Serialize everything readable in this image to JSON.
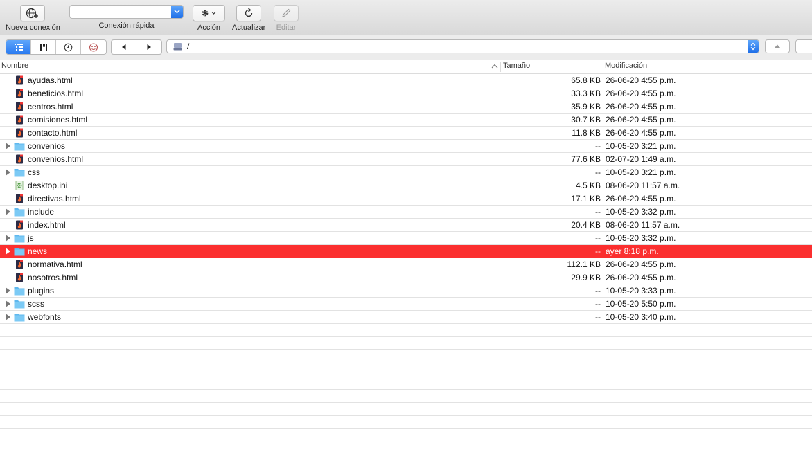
{
  "toolbar": {
    "new_connection_label": "Nueva conexión",
    "quick_connect_label": "Conexión rápida",
    "quick_connect_value": "",
    "action_label": "Acción",
    "refresh_label": "Actualizar",
    "edit_label": "Editar"
  },
  "navbar": {
    "path": "/"
  },
  "columns": {
    "name": "Nombre",
    "size": "Tamaño",
    "modified": "Modificación"
  },
  "colors": {
    "selection": "#fb2f2f",
    "folder": "#5fb8ee",
    "accent": "#2a7af0"
  },
  "files": [
    {
      "name": "ayudas.html",
      "kind": "html",
      "size": "65.8 KB",
      "modified": "26-06-20 4:55 p.m."
    },
    {
      "name": "beneficios.html",
      "kind": "html",
      "size": "33.3 KB",
      "modified": "26-06-20 4:55 p.m."
    },
    {
      "name": "centros.html",
      "kind": "html",
      "size": "35.9 KB",
      "modified": "26-06-20 4:55 p.m."
    },
    {
      "name": "comisiones.html",
      "kind": "html",
      "size": "30.7 KB",
      "modified": "26-06-20 4:55 p.m."
    },
    {
      "name": "contacto.html",
      "kind": "html",
      "size": "11.8 KB",
      "modified": "26-06-20 4:55 p.m."
    },
    {
      "name": "convenios",
      "kind": "folder",
      "size": "--",
      "modified": "10-05-20 3:21 p.m."
    },
    {
      "name": "convenios.html",
      "kind": "html",
      "size": "77.6 KB",
      "modified": "02-07-20 1:49 a.m."
    },
    {
      "name": "css",
      "kind": "folder",
      "size": "--",
      "modified": "10-05-20 3:21 p.m."
    },
    {
      "name": "desktop.ini",
      "kind": "ini",
      "size": "4.5 KB",
      "modified": "08-06-20 11:57 a.m."
    },
    {
      "name": "directivas.html",
      "kind": "html",
      "size": "17.1 KB",
      "modified": "26-06-20 4:55 p.m."
    },
    {
      "name": "include",
      "kind": "folder",
      "size": "--",
      "modified": "10-05-20 3:32 p.m."
    },
    {
      "name": "index.html",
      "kind": "html",
      "size": "20.4 KB",
      "modified": "08-06-20 11:57 a.m."
    },
    {
      "name": "js",
      "kind": "folder",
      "size": "--",
      "modified": "10-05-20 3:32 p.m."
    },
    {
      "name": "news",
      "kind": "folder",
      "size": "--",
      "modified": "ayer 8:18 p.m.",
      "selected": true
    },
    {
      "name": "normativa.html",
      "kind": "html",
      "size": "112.1 KB",
      "modified": "26-06-20 4:55 p.m."
    },
    {
      "name": "nosotros.html",
      "kind": "html",
      "size": "29.9 KB",
      "modified": "26-06-20 4:55 p.m."
    },
    {
      "name": "plugins",
      "kind": "folder",
      "size": "--",
      "modified": "10-05-20 3:33 p.m."
    },
    {
      "name": "scss",
      "kind": "folder",
      "size": "--",
      "modified": "10-05-20 5:50 p.m."
    },
    {
      "name": "webfonts",
      "kind": "folder",
      "size": "--",
      "modified": "10-05-20 3:40 p.m."
    }
  ]
}
